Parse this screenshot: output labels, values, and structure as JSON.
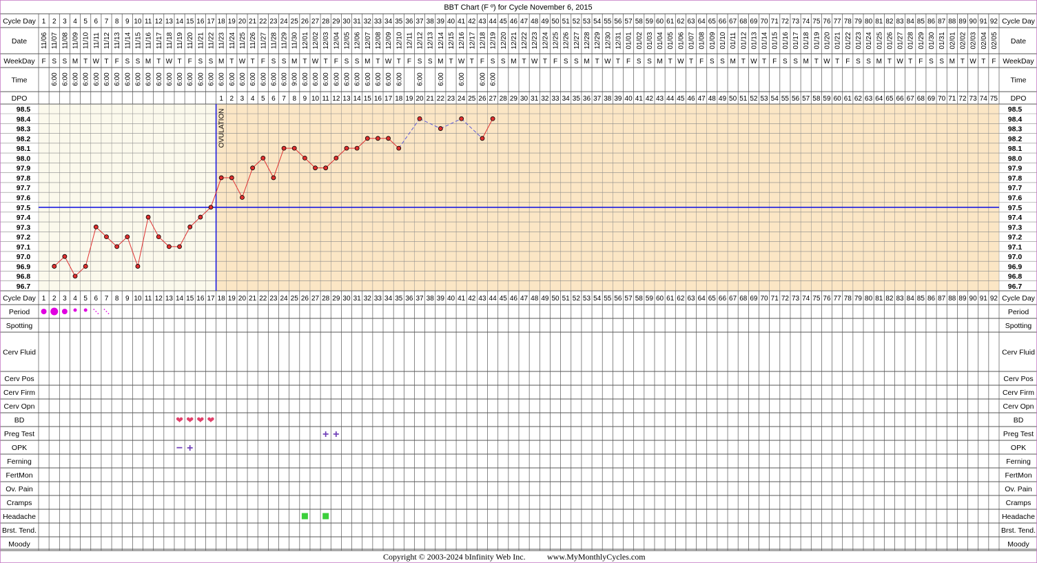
{
  "chart_data": {
    "type": "line",
    "title": "BBT Chart (F º) for Cycle November 6, 2015",
    "copyright": "Copyright © 2003-2024 bInfinity Web Inc.",
    "website": "www.MyMonthlyCycles.com",
    "ovulation_label": "OVULATION",
    "ovulation_day": 17,
    "coverline": 97.5,
    "ylim": [
      96.7,
      98.5
    ],
    "yticks": [
      "98.5",
      "98.4",
      "98.3",
      "98.2",
      "98.1",
      "98.0",
      "97.9",
      "97.8",
      "97.7",
      "97.6",
      "97.5",
      "97.4",
      "97.3",
      "97.2",
      "97.1",
      "97.0",
      "96.9",
      "96.8",
      "96.7"
    ],
    "grid": true,
    "day_count": 92,
    "row_labels": {
      "cycle_day": "Cycle Day",
      "date": "Date",
      "weekday": "WeekDay",
      "time": "Time",
      "dpo": "DPO"
    },
    "dates": [
      "11/06",
      "11/07",
      "11/08",
      "11/09",
      "11/10",
      "11/11",
      "11/12",
      "11/13",
      "11/14",
      "11/15",
      "11/16",
      "11/17",
      "11/18",
      "11/19",
      "11/20",
      "11/21",
      "11/22",
      "11/23",
      "11/24",
      "11/25",
      "11/26",
      "11/27",
      "11/28",
      "11/29",
      "11/30",
      "12/01",
      "12/02",
      "12/03",
      "12/04",
      "12/05",
      "12/06",
      "12/07",
      "12/08",
      "12/09",
      "12/10",
      "12/11",
      "12/12",
      "12/13",
      "12/14",
      "12/15",
      "12/16",
      "12/17",
      "12/18",
      "12/19",
      "12/20",
      "12/21",
      "12/22",
      "12/23",
      "12/24",
      "12/25",
      "12/26",
      "12/27",
      "12/28",
      "12/29",
      "12/30",
      "12/31",
      "01/01",
      "01/02",
      "01/03",
      "01/04",
      "01/05",
      "01/06",
      "01/07",
      "01/08",
      "01/09",
      "01/10",
      "01/11",
      "01/12",
      "01/13",
      "01/14",
      "01/15",
      "01/16",
      "01/17",
      "01/18",
      "01/19",
      "01/20",
      "01/21",
      "01/22",
      "01/23",
      "01/24",
      "01/25",
      "01/26",
      "01/27",
      "01/28",
      "01/29",
      "01/30",
      "01/31",
      "02/01",
      "02/02",
      "02/03",
      "02/04",
      "02/05"
    ],
    "weekdays": [
      "F",
      "S",
      "S",
      "M",
      "T",
      "W",
      "T",
      "F",
      "S",
      "S",
      "M",
      "T",
      "W",
      "T",
      "F",
      "S",
      "S",
      "M",
      "T",
      "W",
      "T",
      "F",
      "S",
      "S",
      "M",
      "T",
      "W",
      "T",
      "F",
      "S",
      "S",
      "M",
      "T",
      "W",
      "T",
      "F",
      "S",
      "S",
      "M",
      "T",
      "W",
      "T",
      "F",
      "S",
      "S",
      "M",
      "T",
      "W",
      "T",
      "F",
      "S",
      "S",
      "M",
      "T",
      "W",
      "T",
      "F",
      "S",
      "S",
      "M",
      "T",
      "W",
      "T",
      "F",
      "S",
      "S",
      "M",
      "T",
      "W",
      "T",
      "F",
      "S",
      "S",
      "M",
      "T",
      "W",
      "T",
      "F",
      "S",
      "S",
      "M",
      "T",
      "W",
      "T",
      "F",
      "S",
      "S",
      "M",
      "T",
      "W",
      "T",
      "F"
    ],
    "times": [
      "",
      "6:00",
      "6:00",
      "6:00",
      "6:00",
      "6:00",
      "6:00",
      "6:00",
      "6:00",
      "6:00",
      "6:00",
      "6:00",
      "6:00",
      "6:00",
      "6:00",
      "6:00",
      "6:00",
      "6:00",
      "6:00",
      "6:00",
      "6:00",
      "6:00",
      "6:00",
      "6:00",
      "9:00",
      "6:00",
      "6:00",
      "6:00",
      "6:00",
      "6:00",
      "6:00",
      "6:00",
      "6:00",
      "6:00",
      "6:00",
      "",
      "6:00",
      "",
      "6:00",
      "",
      "6:00",
      "",
      "6:00",
      "6:00"
    ],
    "temps": [
      null,
      96.9,
      97.0,
      96.8,
      96.9,
      97.3,
      97.2,
      97.1,
      97.2,
      96.9,
      97.4,
      97.2,
      97.1,
      97.1,
      97.3,
      97.4,
      97.5,
      97.8,
      97.8,
      97.6,
      97.9,
      98.0,
      97.8,
      98.1,
      98.1,
      98.0,
      97.9,
      97.9,
      98.0,
      98.1,
      98.1,
      98.2,
      98.2,
      98.2,
      98.1,
      null,
      98.4,
      null,
      98.3,
      null,
      98.4,
      null,
      98.2,
      98.4
    ],
    "period_rows": [
      "Period",
      "Spotting",
      "Cerv Fluid",
      "Cerv Pos",
      "Cerv Firm",
      "Cerv Opn",
      "BD",
      "Preg Test",
      "OPK",
      "Ferning",
      "FertMon",
      "Ov. Pain",
      "Cramps",
      "Headache",
      "Brst. Tend.",
      "Moody"
    ],
    "period": [
      {
        "day": 1,
        "size": "medium"
      },
      {
        "day": 2,
        "size": "large"
      },
      {
        "day": 3,
        "size": "medium"
      },
      {
        "day": 4,
        "size": "small"
      },
      {
        "day": 5,
        "size": "small"
      },
      {
        "day": 6,
        "size": "spotting"
      },
      {
        "day": 7,
        "size": "spotting"
      }
    ],
    "bd_days": [
      14,
      15,
      16,
      17
    ],
    "preg_test": [
      {
        "day": 28,
        "result": "+"
      },
      {
        "day": 29,
        "result": "+"
      }
    ],
    "opk": [
      {
        "day": 14,
        "result": "−"
      },
      {
        "day": 15,
        "result": "+"
      }
    ],
    "headache_days": [
      26,
      28
    ],
    "colors": {
      "pre_ov_bg": "#fbf9ec",
      "post_ov_bg": "#fbe6c5",
      "line": "#e03030",
      "point": "#e03030",
      "dashed": "#5a5ad8",
      "coverline": "#1a1ae0",
      "ovulation": "#1a1ae0",
      "period": "#e000e0",
      "bd": "#e0406a",
      "test": "#7040b8",
      "headache": "#3ccf3c",
      "border": "#c070c0"
    }
  }
}
